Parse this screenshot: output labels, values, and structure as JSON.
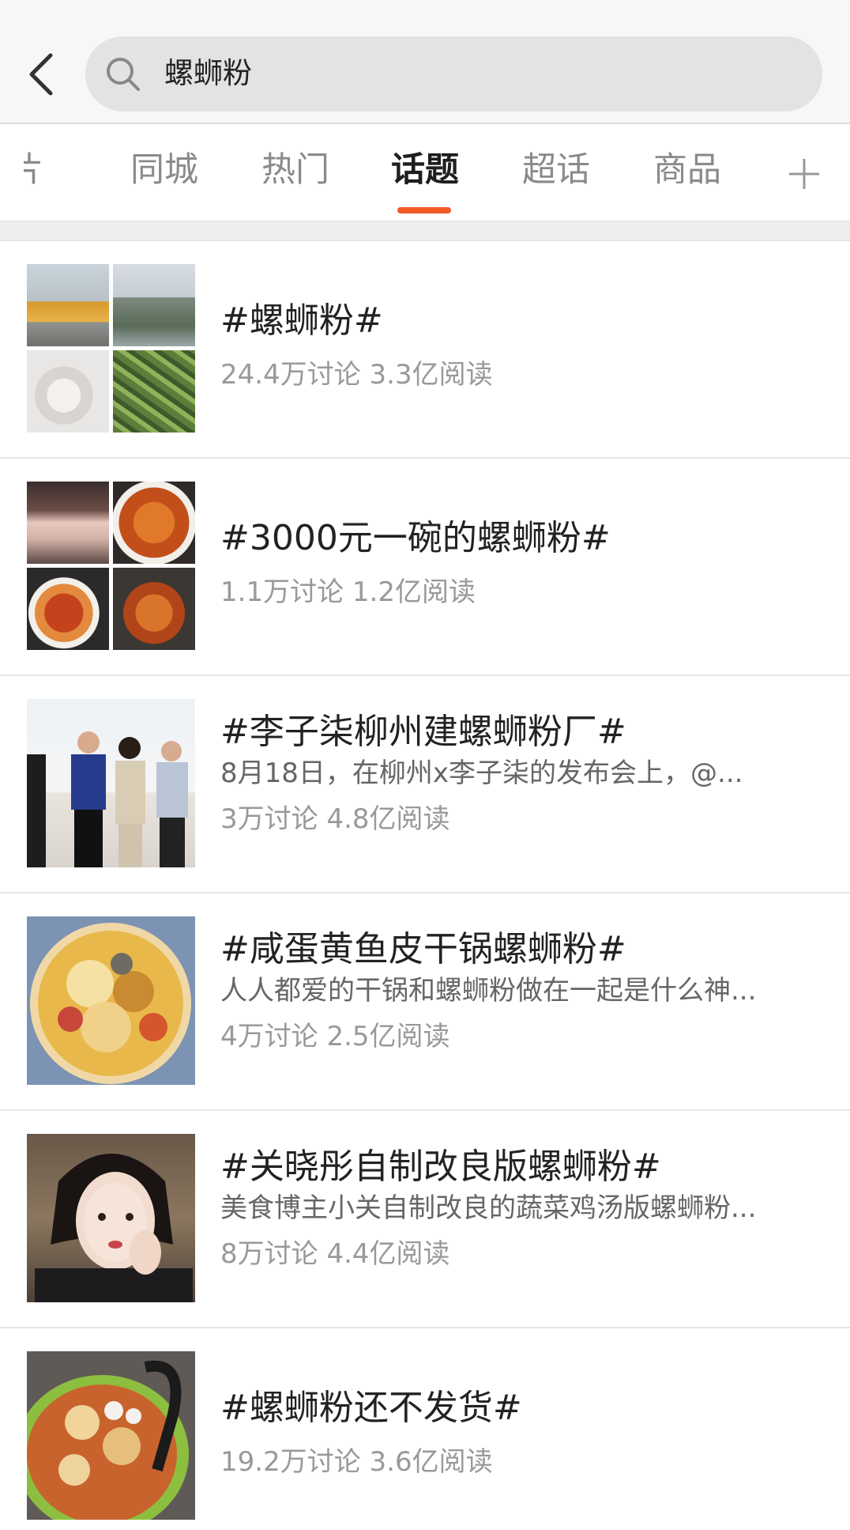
{
  "search": {
    "query": "螺蛳粉"
  },
  "tabs": [
    {
      "label": "片"
    },
    {
      "label": "同城"
    },
    {
      "label": "热门"
    },
    {
      "label": "话题"
    },
    {
      "label": "超话"
    },
    {
      "label": "商品"
    }
  ],
  "active_tab": "话题",
  "colors": {
    "accent": "#f05a24",
    "search_bg": "#e3e3e3",
    "header_bg": "#f7f7f7"
  },
  "icons": {
    "back": "chevron-left-icon",
    "search": "search-icon",
    "add": "plus-icon"
  },
  "topics": [
    {
      "title": "#螺蛳粉#",
      "desc": "",
      "stats": "24.4万讨论 3.3亿阅读"
    },
    {
      "title": "#3000元一碗的螺蛳粉#",
      "desc": "",
      "stats": "1.1万讨论 1.2亿阅读"
    },
    {
      "title": "#李子柒柳州建螺蛳粉厂#",
      "desc": "8月18日，在柳州x李子柒的发布会上，@...",
      "stats": "3万讨论 4.8亿阅读"
    },
    {
      "title": "#咸蛋黄鱼皮干锅螺蛳粉#",
      "desc": "人人都爱的干锅和螺蛳粉做在一起是什么神...",
      "stats": "4万讨论 2.5亿阅读"
    },
    {
      "title": "#关晓彤自制改良版螺蛳粉#",
      "desc": "美食博主小关自制改良的蔬菜鸡汤版螺蛳粉...",
      "stats": "8万讨论 4.4亿阅读"
    },
    {
      "title": "#螺蛳粉还不发货#",
      "desc": "",
      "stats": "19.2万讨论 3.6亿阅读"
    }
  ]
}
